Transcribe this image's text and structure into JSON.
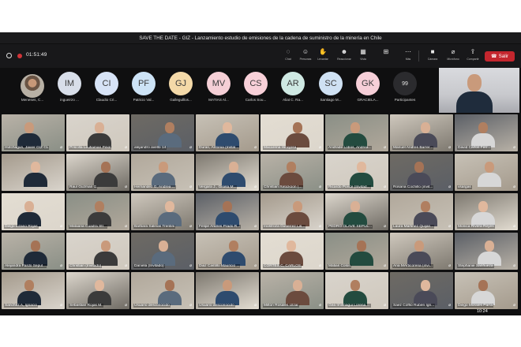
{
  "window_title": "SAVE THE DATE - GIZ - Lanzamiento estudio de emisiones de la cadena de suministro de la minería en Chile",
  "toolbar": {
    "timer": "01:51:49",
    "buttons": [
      {
        "icon": "chat-icon",
        "label": "Chat"
      },
      {
        "icon": "people-icon",
        "label": "Personas"
      },
      {
        "icon": "raise-hand-icon",
        "label": "Levantar"
      },
      {
        "icon": "react-icon",
        "label": "Reaccionar"
      },
      {
        "icon": "view-icon",
        "label": "Vista"
      },
      {
        "icon": "more-icon",
        "label": "Más"
      },
      {
        "icon": "camera-icon",
        "label": "Cámara"
      },
      {
        "icon": "mic-off-icon",
        "label": "Micrófono"
      },
      {
        "icon": "share-icon",
        "label": "Compartir"
      }
    ],
    "leave_label": "Salir"
  },
  "avatar_row": [
    {
      "initials": "",
      "name": "Meneses, C...",
      "color": ""
    },
    {
      "initials": "IM",
      "name": "ingueirzo ...",
      "color": "#d8dee9"
    },
    {
      "initials": "CI",
      "name": "Claudio Cri...",
      "color": "#d7e3f6"
    },
    {
      "initials": "PF",
      "name": "Patricio Val...",
      "color": "#cde3f6"
    },
    {
      "initials": "GJ",
      "name": "Gallegulllos...",
      "color": "#f4d9a8"
    },
    {
      "initials": "MV",
      "name": "MATIAS Al...",
      "color": "#f5cfd6"
    },
    {
      "initials": "CS",
      "name": "Carlos Sou...",
      "color": "#f8d0d8"
    },
    {
      "initials": "AR",
      "name": "Aliat C. Ra...",
      "color": "#cfe9e3"
    },
    {
      "initials": "SC",
      "name": "Santiago M...",
      "color": "#cfe1f3"
    },
    {
      "initials": "GK",
      "name": "GRACIELA...",
      "color": "#f6cfd8"
    }
  ],
  "participants": {
    "count": "99",
    "label": "Participantes"
  },
  "tiles": [
    [
      "Hutchagun, Javier GIZ CL",
      "Priscilla Leufiaman Pinol",
      "alejandro avello 14",
      "Duran, Antonia (Instal...",
      "Macarena Hinojosa",
      "Andrade Lobos, Andrea...",
      "Manuel Andres Barrer...",
      "David Carlos Ferr..."
    ],
    [
      "",
      "Raul Guzman G",
      "Hernandez G, Andrea ...",
      "Vergara J., Gisela M...",
      "Christian Retickoon (...",
      "Ricardo Ponce (Invitad...",
      "Rosana Cochillo (invit...",
      "vsargas"
    ],
    [
      "Diego Lizano Rojas",
      "Mataana Cuadra Str...",
      "Barbara Salinas Trentini",
      "Felipe Andres Prado R...",
      "Inostroza Gutierrez Lis...",
      "PEDRO OLAVE SEPUL...",
      "Laura Martinez Quijan...",
      "Monica Rivera Reyes"
    ],
    [
      "Alejandra Pardo Sepul...",
      "Christian (Invitado)",
      "Daniela (Invitado)",
      "Diaz Castillo Mauricio ...",
      "CORTES C, CARLOS",
      "Matias Colon",
      "Ana MArticorena (invi...",
      "Stephanie Sanhueza"
    ],
    [
      "Sanchez A, Ignacio",
      "Sebastian Rojas M.",
      "Usuario desconocido",
      "Usuario desconocido",
      "Milton Rosales Ulzar",
      "Gea Imilmagui Lorena ...",
      "Saez Coffio Rubén Ign...",
      "Diego Morales Parra"
    ]
  ],
  "clock": "10:24"
}
